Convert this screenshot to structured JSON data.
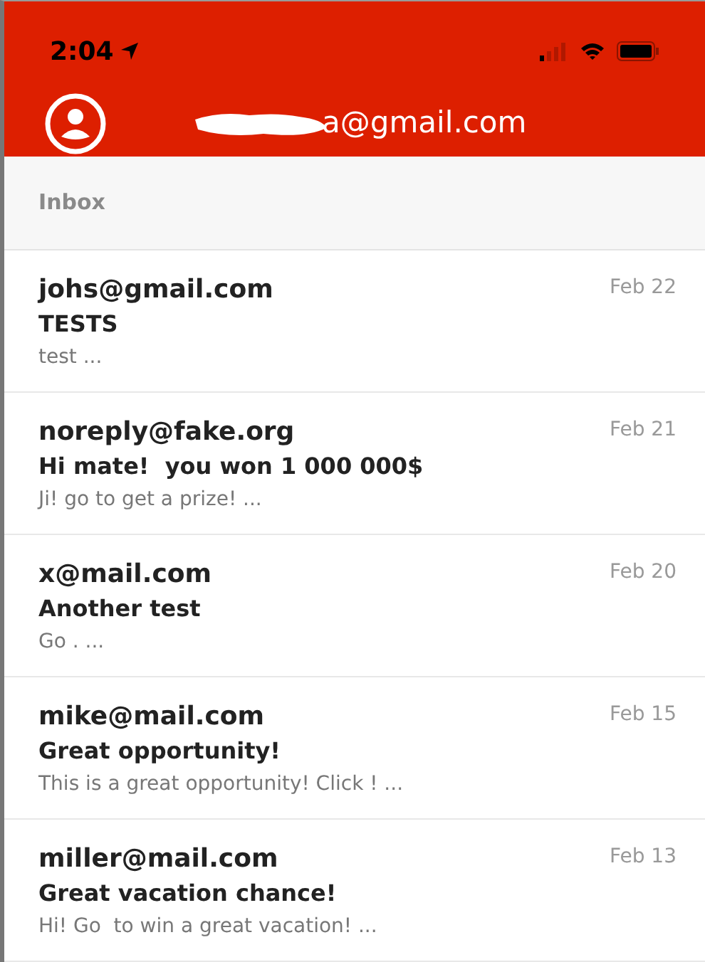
{
  "status_bar": {
    "time": "2:04"
  },
  "header": {
    "account": "a@gmail.com"
  },
  "section": {
    "title": "Inbox"
  },
  "messages": [
    {
      "sender": "johs@gmail.com",
      "subject": "TESTS",
      "preview": "test ...",
      "date": "Feb 22"
    },
    {
      "sender": "noreply@fake.org",
      "subject": "Hi mate!  you won 1 000 000$",
      "preview": "Ji! go to get a prize! ...",
      "date": "Feb 21"
    },
    {
      "sender": "x@mail.com",
      "subject": "Another test",
      "preview": "Go . ...",
      "date": "Feb 20"
    },
    {
      "sender": "mike@mail.com",
      "subject": "Great opportunity!",
      "preview": "This is a great opportunity! Click ! ...",
      "date": "Feb 15"
    },
    {
      "sender": "miller@mail.com",
      "subject": "Great vacation chance!",
      "preview": "Hi! Go  to win a great vacation! ...",
      "date": "Feb 13"
    }
  ]
}
